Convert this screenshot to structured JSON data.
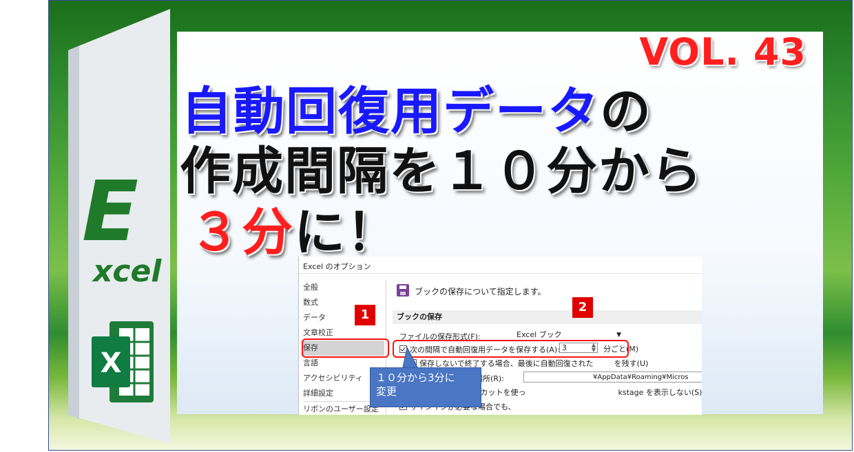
{
  "thumbnail": {
    "volume": "VOL. 43",
    "title_line1": {
      "blue": "自動回復用データ",
      "black": "の"
    },
    "title_line2": "作成間隔を１０分から",
    "title_line3": {
      "red": "３分",
      "black": "に！"
    },
    "logo": {
      "letter": "E",
      "word": "xcel",
      "icon_letter": "X"
    }
  },
  "dialog": {
    "title": "Excel のオプション",
    "nav_items": [
      "全般",
      "数式",
      "データ",
      "文章校正",
      "保存",
      "言語",
      "アクセシビリティ",
      "詳細設定",
      "リボンのユーザー設定"
    ],
    "selected_nav": "保存",
    "header": "ブックの保存について指定します。",
    "section_title": "ブックの保存",
    "format_label": "ファイルの保存形式(F):",
    "format_value": "Excel ブック",
    "autorecover_label": "次の間隔で自動回復用データを保存する(A):",
    "autorecover_value": "3",
    "minutes_label": "分ごと(M)",
    "keep_last_label": "保存しないで終了する場合、最後に自動回復された",
    "keep_last_tail": "を残す(U)",
    "location_label": "自動回復用ファイルの場所(R):",
    "location_value": "¥AppData¥Roaming¥Micros",
    "keyboard_label": "キーボード ショートカットを使っ",
    "keyboard_tail": "kstage を表示しない(S)",
    "signin_label": "サインインが必要な場合でも、"
  },
  "annotations": {
    "badge1": "1",
    "badge2": "2",
    "callout": "１０分から3分に\n変更"
  },
  "colors": {
    "accent_red": "#ff1e1e",
    "title_blue": "#1919ff",
    "excel_green": "#1e7b3a",
    "callout_blue": "#4a76c4"
  }
}
